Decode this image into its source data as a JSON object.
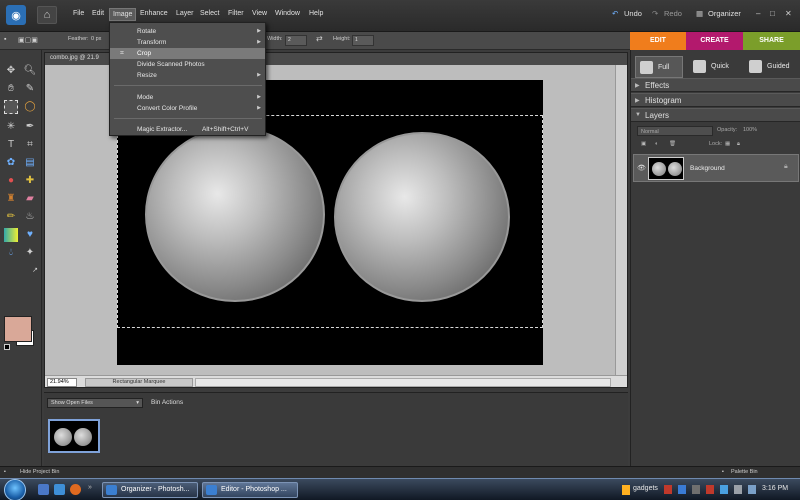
{
  "menubar": {
    "items": [
      "File",
      "Edit",
      "Image",
      "Enhance",
      "Layer",
      "Select",
      "Filter",
      "View",
      "Window",
      "Help"
    ],
    "undo": "Undo",
    "redo": "Redo",
    "organizer": "Organizer",
    "window_controls": [
      "–",
      "□",
      "✕"
    ]
  },
  "options": {
    "feather_label": "Feather:",
    "feather_value": "0 px",
    "width_label": "Width:",
    "width_value": "2",
    "height_label": "Height:",
    "height_value": "1"
  },
  "mode_tabs": [
    {
      "label": "EDIT",
      "color": "#f07d1c"
    },
    {
      "label": "CREATE",
      "color": "#b3196d"
    },
    {
      "label": "SHARE",
      "color": "#7b9e2a"
    }
  ],
  "document": {
    "title": "combo.jpg @ 21.9",
    "zoom": "21.94%",
    "status_label": "Rectangular Marquee"
  },
  "image_menu": {
    "items": [
      {
        "label": "Rotate",
        "submenu": true
      },
      {
        "label": "Transform",
        "submenu": true
      },
      {
        "label": "Crop",
        "submenu": false,
        "highlighted": true
      },
      {
        "label": "Divide Scanned Photos",
        "submenu": false
      },
      {
        "label": "Resize",
        "submenu": true
      },
      {
        "label": "Mode",
        "submenu": true
      },
      {
        "label": "Convert Color Profile",
        "submenu": true
      },
      {
        "label": "Magic Extractor...",
        "shortcut": "Alt+Shift+Ctrl+V"
      }
    ]
  },
  "right_panel": {
    "modes": [
      "Full",
      "Quick",
      "Guided"
    ],
    "palettes": [
      "Effects",
      "Histogram",
      "Layers"
    ],
    "blend_mode": "Normal",
    "opacity_label": "Opacity:",
    "opacity_value": "100%",
    "lock_label": "Lock:",
    "layer_name": "Background"
  },
  "bin": {
    "show_select": "Show Open Files",
    "actions": "Bin Actions",
    "hide_label": "Hide Project Bin",
    "palette_label": "Palette Bin"
  },
  "taskbar": {
    "tasks": [
      "Organizer - Photosh...",
      "Editor - Photoshop ..."
    ],
    "gadgets": "gadgets",
    "clock": "3:16 PM"
  },
  "colors": {
    "foreground": "#d9a898",
    "background": "#ffffff",
    "accent_edit": "#f07d1c"
  }
}
